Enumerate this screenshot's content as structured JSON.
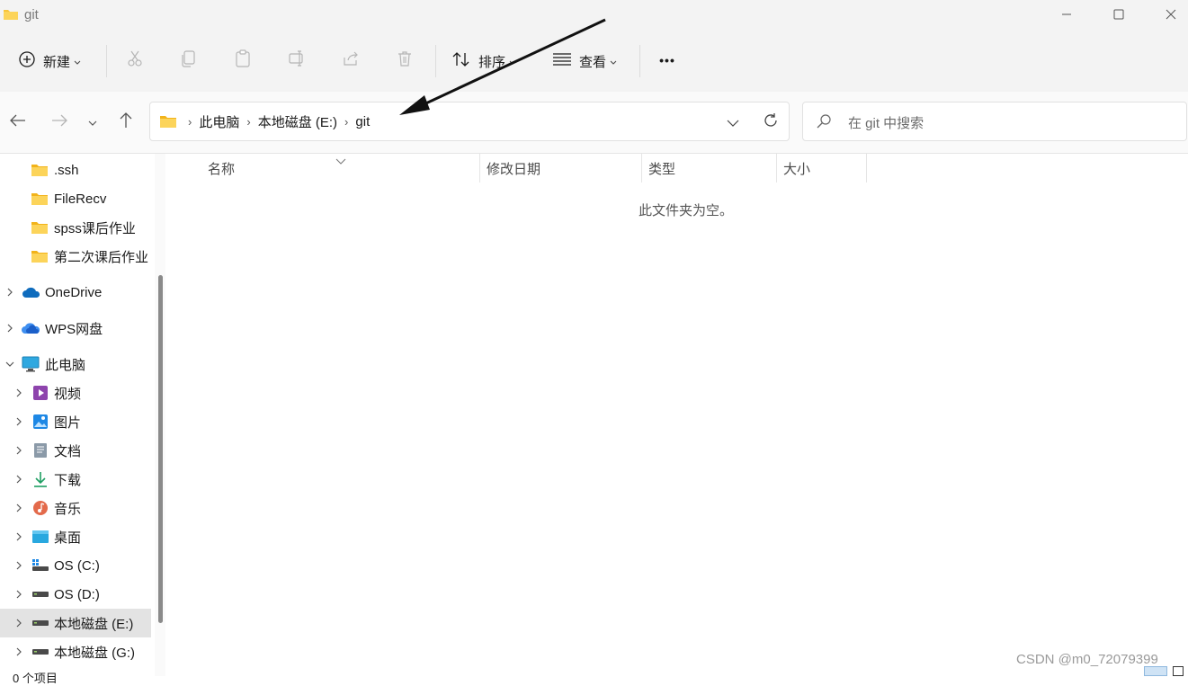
{
  "window": {
    "title": "git",
    "minimize_icon": "minimize-icon",
    "maximize_icon": "maximize-icon",
    "close_icon": "close-icon"
  },
  "toolbar": {
    "new_label": "新建",
    "sort_label": "排序",
    "view_label": "查看",
    "more_label": "•••",
    "icons": [
      "plus-circle-icon",
      "cut-icon",
      "copy-icon",
      "paste-icon",
      "rename-icon",
      "share-icon",
      "delete-icon",
      "sort-icon",
      "view-list-icon",
      "more-icon"
    ]
  },
  "address_bar": {
    "crumbs": [
      "此电脑",
      "本地磁盘 (E:)",
      "git"
    ],
    "separator": "›"
  },
  "search": {
    "placeholder": "在 git 中搜索"
  },
  "sidebar": {
    "items": [
      {
        "label": ".ssh",
        "icon": "folder-icon"
      },
      {
        "label": "FileRecv",
        "icon": "folder-icon"
      },
      {
        "label": "spss课后作业",
        "icon": "folder-icon"
      },
      {
        "label": "第二次课后作业",
        "icon": "folder-icon"
      },
      {
        "label": "OneDrive",
        "icon": "onedrive-cloud-icon"
      },
      {
        "label": "WPS网盘",
        "icon": "wps-cloud-icon"
      },
      {
        "label": "此电脑",
        "icon": "computer-icon"
      },
      {
        "label": "视频",
        "icon": "video-icon"
      },
      {
        "label": "图片",
        "icon": "picture-icon"
      },
      {
        "label": "文档",
        "icon": "document-icon"
      },
      {
        "label": "下载",
        "icon": "download-icon"
      },
      {
        "label": "音乐",
        "icon": "music-icon"
      },
      {
        "label": "桌面",
        "icon": "desktop-icon"
      },
      {
        "label": "OS (C:)",
        "icon": "system-drive-icon"
      },
      {
        "label": "OS (D:)",
        "icon": "drive-icon"
      },
      {
        "label": "本地磁盘 (E:)",
        "icon": "drive-icon"
      },
      {
        "label": "本地磁盘 (G:)",
        "icon": "drive-icon"
      }
    ]
  },
  "content": {
    "columns": [
      "名称",
      "修改日期",
      "类型",
      "大小"
    ],
    "empty_message": "此文件夹为空。"
  },
  "status": {
    "item_count": "0 个项目"
  },
  "watermark": "CSDN @m0_72079399",
  "colors": {
    "chrome_bg": "#f3f3f3",
    "accent_blue": "#0067c0",
    "folder_yellow": "#f8c53a",
    "selected_bg": "#e3e3e3"
  }
}
